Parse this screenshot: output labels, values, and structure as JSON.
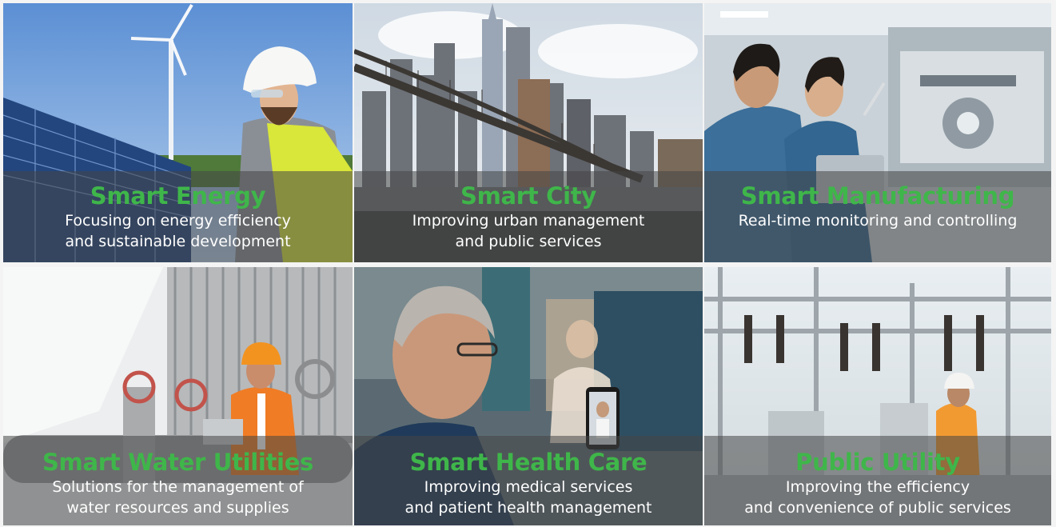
{
  "colors": {
    "title_green": "#3fb64a",
    "caption_text": "#ffffff",
    "caption_overlay": "rgba(70,70,70,0.55)"
  },
  "cards": [
    {
      "title": "Smart Energy",
      "desc_line1": "Focusing on energy efficiency",
      "desc_line2": "and sustainable development",
      "image": "engineer-with-wind-turbine-and-solar-panels"
    },
    {
      "title": "Smart City",
      "desc_line1": "Improving urban management",
      "desc_line2": "and public services",
      "image": "city-skyline-with-bridge"
    },
    {
      "title": "Smart Manufacturing",
      "desc_line1": "Real-time monitoring and controlling",
      "desc_line2": "",
      "image": "workers-inspecting-machinery"
    },
    {
      "title": "Smart Water Utilities",
      "desc_line1": "Solutions for the management of",
      "desc_line2": "water resources and supplies",
      "image": "engineer-at-water-pipes-and-valves"
    },
    {
      "title": "Smart Health Care",
      "desc_line1": "Improving medical services",
      "desc_line2": "and patient health management",
      "image": "patient-on-video-call-with-doctor"
    },
    {
      "title": "Public Utility",
      "desc_line1": "Improving the efficiency",
      "desc_line2": "and convenience of public services",
      "image": "worker-at-electrical-substation"
    }
  ]
}
